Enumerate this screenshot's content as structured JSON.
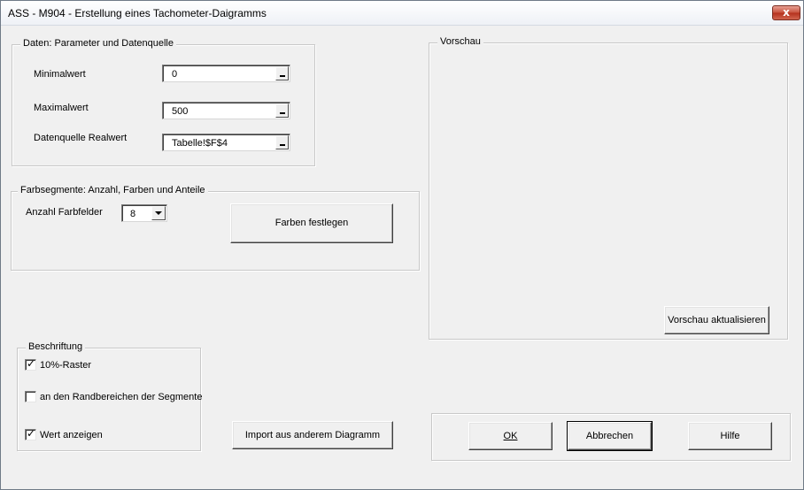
{
  "window": {
    "title": "ASS - M904 - Erstellung eines Tachometer-Daigramms",
    "close_glyph": "x"
  },
  "daten": {
    "legend": "Daten: Parameter und Datenquelle",
    "min_label": "Minimalwert",
    "min_value": "0",
    "max_label": "Maximalwert",
    "max_value": "500",
    "quelle_label": "Datenquelle Realwert",
    "quelle_value": "Tabelle!$F$4"
  },
  "farbsegmente": {
    "legend": "Farbsegmente: Anzahl, Farben und Anteile",
    "anzahl_label": "Anzahl Farbfelder",
    "anzahl_value": "8",
    "farben_button": "Farben festlegen"
  },
  "vorschau": {
    "legend": "Vorschau",
    "refresh_button": "Vorschau aktualisieren"
  },
  "beschriftung": {
    "legend": "Beschriftung",
    "items": [
      {
        "label": "10%-Raster",
        "checked": true
      },
      {
        "label": "an den Randbereichen der Segmente",
        "checked": false
      },
      {
        "label": "Wert anzeigen",
        "checked": true
      }
    ],
    "check_glyph": "✓"
  },
  "import_button": "Import aus anderem Diagramm",
  "actions": {
    "ok": "OK",
    "cancel": "Abbrechen",
    "help": "Hilfe"
  }
}
